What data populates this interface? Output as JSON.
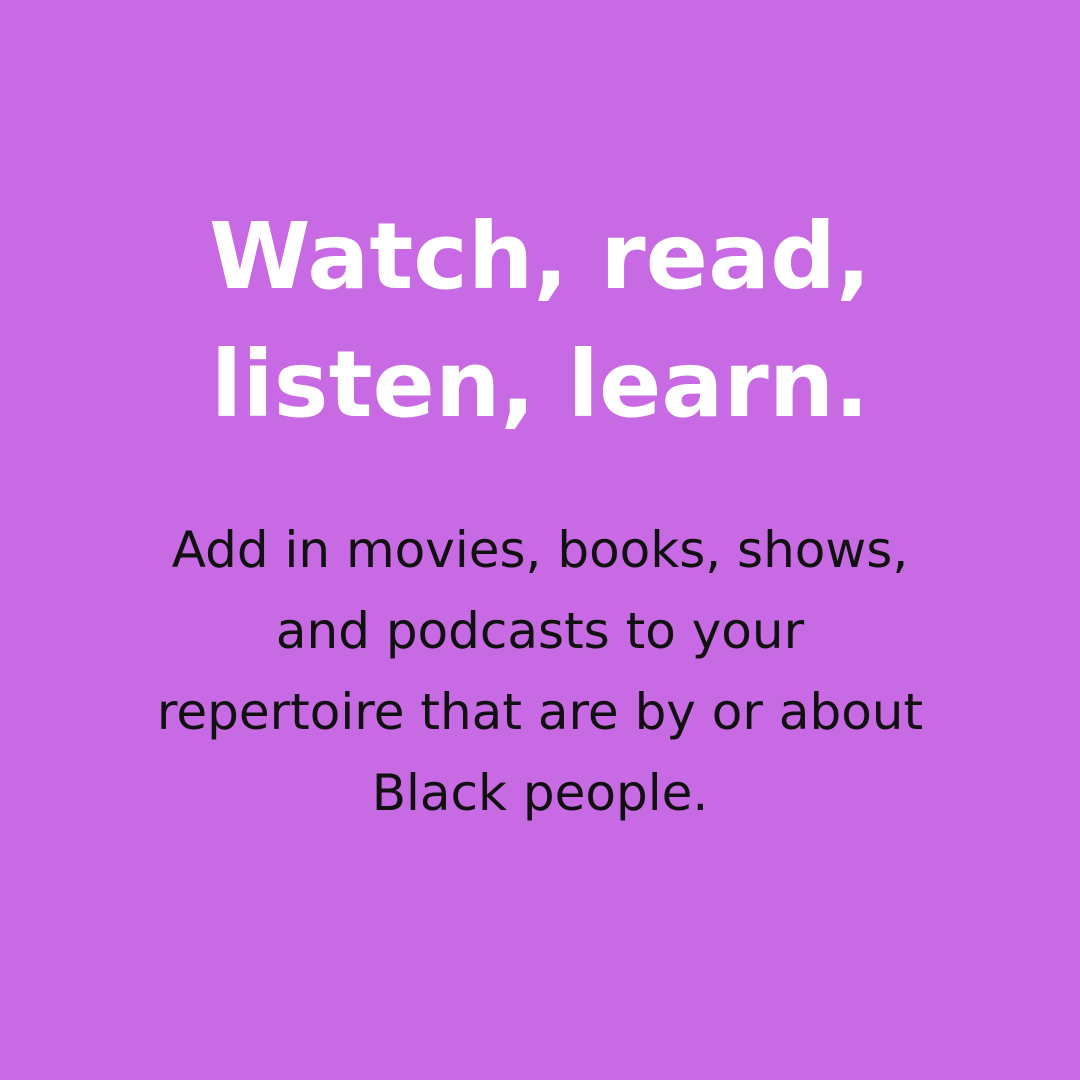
{
  "background_color": "#c76ae4",
  "headline": {
    "lines": [
      "Watch, read,",
      "listen, learn."
    ],
    "color": "#ffffff"
  },
  "body": {
    "lines": [
      "Add in movies, books, shows,",
      "and podcasts to your",
      "repertoire that are by or about",
      "Black people."
    ],
    "color": "#111111"
  }
}
